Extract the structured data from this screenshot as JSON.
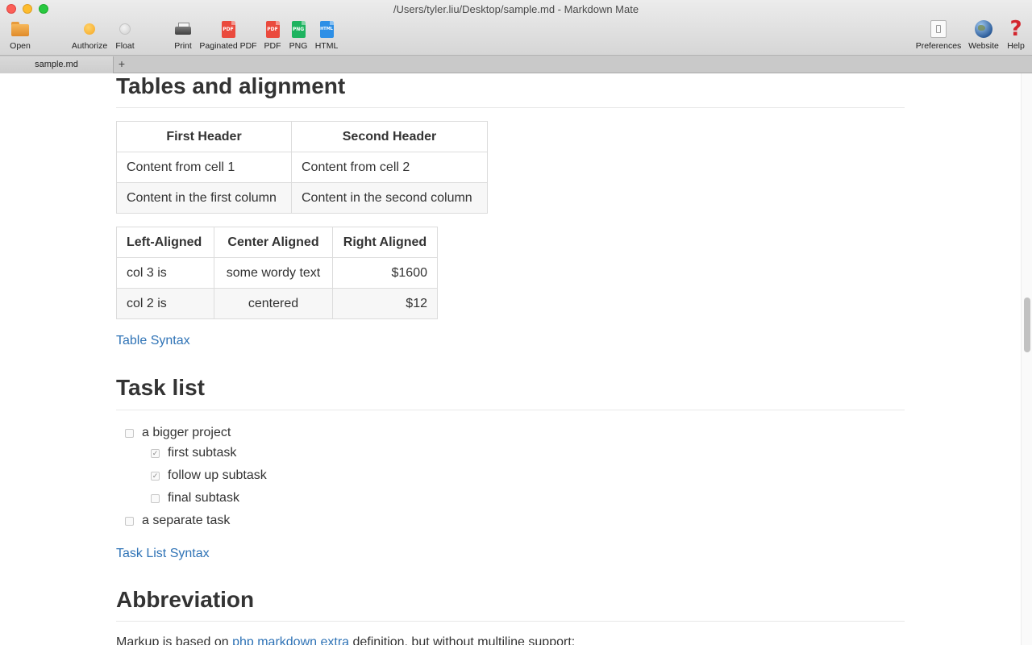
{
  "window": {
    "title": "/Users/tyler.liu/Desktop/sample.md - Markdown Mate"
  },
  "toolbar": {
    "open": "Open",
    "authorize": "Authorize",
    "float": "Float",
    "print": "Print",
    "paginated_pdf": "Paginated PDF",
    "pdf": "PDF",
    "png": "PNG",
    "html": "HTML",
    "preferences": "Preferences",
    "website": "Website",
    "help": "Help",
    "icons": {
      "pdf_glyph": "PDF",
      "png_glyph": "PNG",
      "html_glyph": "HTML",
      "help_glyph": "?"
    }
  },
  "tabs": {
    "active": "sample.md",
    "add": "+"
  },
  "doc": {
    "tables_heading": "Tables and alignment",
    "table1": {
      "headers": [
        "First Header",
        "Second Header"
      ],
      "rows": [
        [
          "Content from cell 1",
          "Content from cell 2"
        ],
        [
          "Content in the first column",
          "Content in the second column"
        ]
      ]
    },
    "table2": {
      "headers": [
        "Left-Aligned",
        "Center Aligned",
        "Right Aligned"
      ],
      "rows": [
        [
          "col 3 is",
          "some wordy text",
          "$1600"
        ],
        [
          "col 2 is",
          "centered",
          "$12"
        ]
      ]
    },
    "table_syntax_link": "Table Syntax",
    "task_heading": "Task list",
    "tasks": [
      {
        "label": "a bigger project",
        "checked": false
      },
      {
        "label": "first subtask",
        "checked": true
      },
      {
        "label": "follow up subtask",
        "checked": true
      },
      {
        "label": "final subtask",
        "checked": false
      },
      {
        "label": "a separate task",
        "checked": false
      }
    ],
    "task_syntax_link": "Task List Syntax",
    "abbr_heading": "Abbreviation",
    "abbr_text_before": "Markup is based on ",
    "abbr_link": "php markdown extra",
    "abbr_text_after": " definition, but without multiline support:"
  },
  "colors": {
    "link": "#2f73b6",
    "text": "#333333",
    "border": "#dcdcdc"
  }
}
